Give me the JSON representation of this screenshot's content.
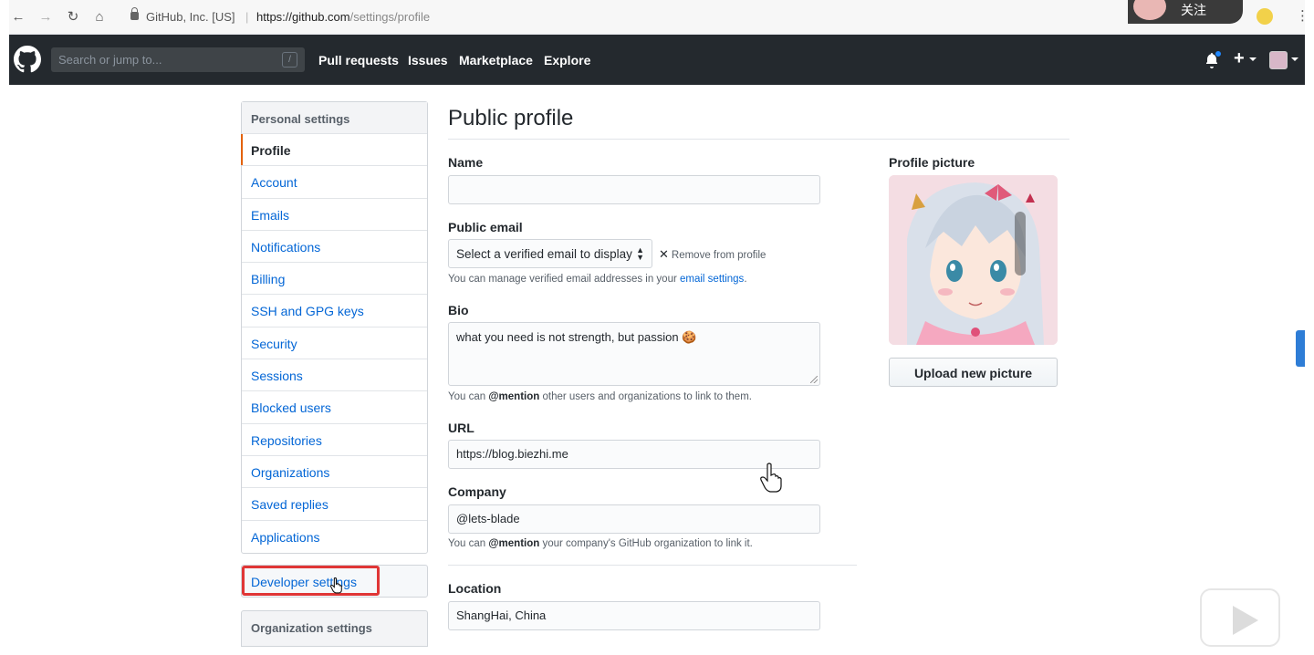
{
  "browser": {
    "address_org": "GitHub, Inc. [US]",
    "url_host": "https://github.com",
    "url_path": "/settings/profile",
    "extension_text": "关注"
  },
  "header": {
    "search_placeholder": "Search or jump to...",
    "search_shortcut": "/",
    "nav": [
      "Pull requests",
      "Issues",
      "Marketplace",
      "Explore"
    ],
    "plus_label": "+"
  },
  "sidebar": {
    "heading": "Personal settings",
    "items": [
      {
        "label": "Profile",
        "selected": true
      },
      {
        "label": "Account"
      },
      {
        "label": "Emails"
      },
      {
        "label": "Notifications"
      },
      {
        "label": "Billing"
      },
      {
        "label": "SSH and GPG keys"
      },
      {
        "label": "Security"
      },
      {
        "label": "Sessions"
      },
      {
        "label": "Blocked users"
      },
      {
        "label": "Repositories"
      },
      {
        "label": "Organizations"
      },
      {
        "label": "Saved replies"
      },
      {
        "label": "Applications"
      }
    ],
    "developer_settings": "Developer settings",
    "organization_settings": "Organization settings"
  },
  "main": {
    "title": "Public profile",
    "name": {
      "label": "Name",
      "value": ""
    },
    "public_email": {
      "label": "Public email",
      "selected": "Select a verified email to display",
      "remove": "Remove from profile",
      "note_before": "You can manage verified email addresses in your ",
      "note_link": "email settings",
      "note_after": "."
    },
    "bio": {
      "label": "Bio",
      "value": "what you need is not strength, but passion 🍪",
      "note_before": "You can ",
      "note_mention": "@mention",
      "note_after": " other users and organizations to link to them."
    },
    "url": {
      "label": "URL",
      "value": "https://blog.biezhi.me"
    },
    "company": {
      "label": "Company",
      "value": "@lets-blade",
      "note_before": "You can ",
      "note_mention": "@mention",
      "note_after": " your company's GitHub organization to link it."
    },
    "location": {
      "label": "Location",
      "value": "ShangHai, China"
    }
  },
  "profile_picture": {
    "label": "Profile picture",
    "upload_button": "Upload new picture"
  }
}
